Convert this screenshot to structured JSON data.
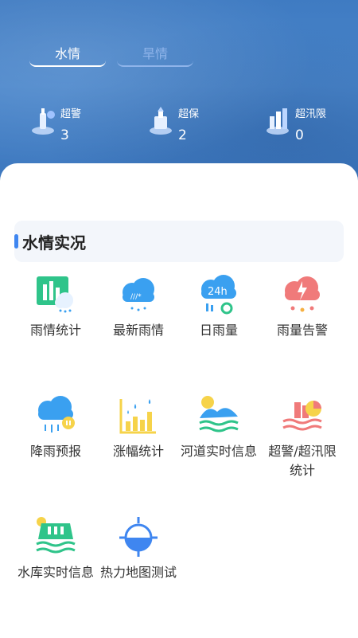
{
  "tabs": [
    {
      "label": "水情",
      "active": true
    },
    {
      "label": "旱情",
      "active": false
    }
  ],
  "stats": [
    {
      "label": "超警",
      "value": "3",
      "icon": "alert-tower-icon"
    },
    {
      "label": "超保",
      "value": "2",
      "icon": "guard-station-icon"
    },
    {
      "label": "超汛限",
      "value": "0",
      "icon": "flood-limit-icon"
    }
  ],
  "section": {
    "title": "水情实况"
  },
  "grid": [
    {
      "label": "雨情统计",
      "icon": "rain-statistics-icon"
    },
    {
      "label": "最新雨情",
      "icon": "latest-rain-icon"
    },
    {
      "label": "日雨量",
      "icon": "daily-rainfall-24h-icon"
    },
    {
      "label": "雨量告警",
      "icon": "rainfall-alert-icon"
    },
    {
      "label": "降雨预报",
      "icon": "rain-forecast-icon"
    },
    {
      "label": "涨幅统计",
      "icon": "rise-statistics-icon"
    },
    {
      "label": "河道实时信息",
      "icon": "river-realtime-icon"
    },
    {
      "label": "超警/超汛限统计",
      "icon": "over-warning-statistics-icon"
    },
    {
      "label": "水库实时信息",
      "icon": "reservoir-realtime-icon"
    },
    {
      "label": "热力地图测试",
      "icon": "heatmap-test-icon"
    }
  ],
  "colors": {
    "hero": "#4a86cb",
    "accent": "#3f86f0",
    "green": "#2fc48a",
    "blue": "#3aa0f0",
    "red": "#f07a7a",
    "yellow": "#f6d34a"
  }
}
